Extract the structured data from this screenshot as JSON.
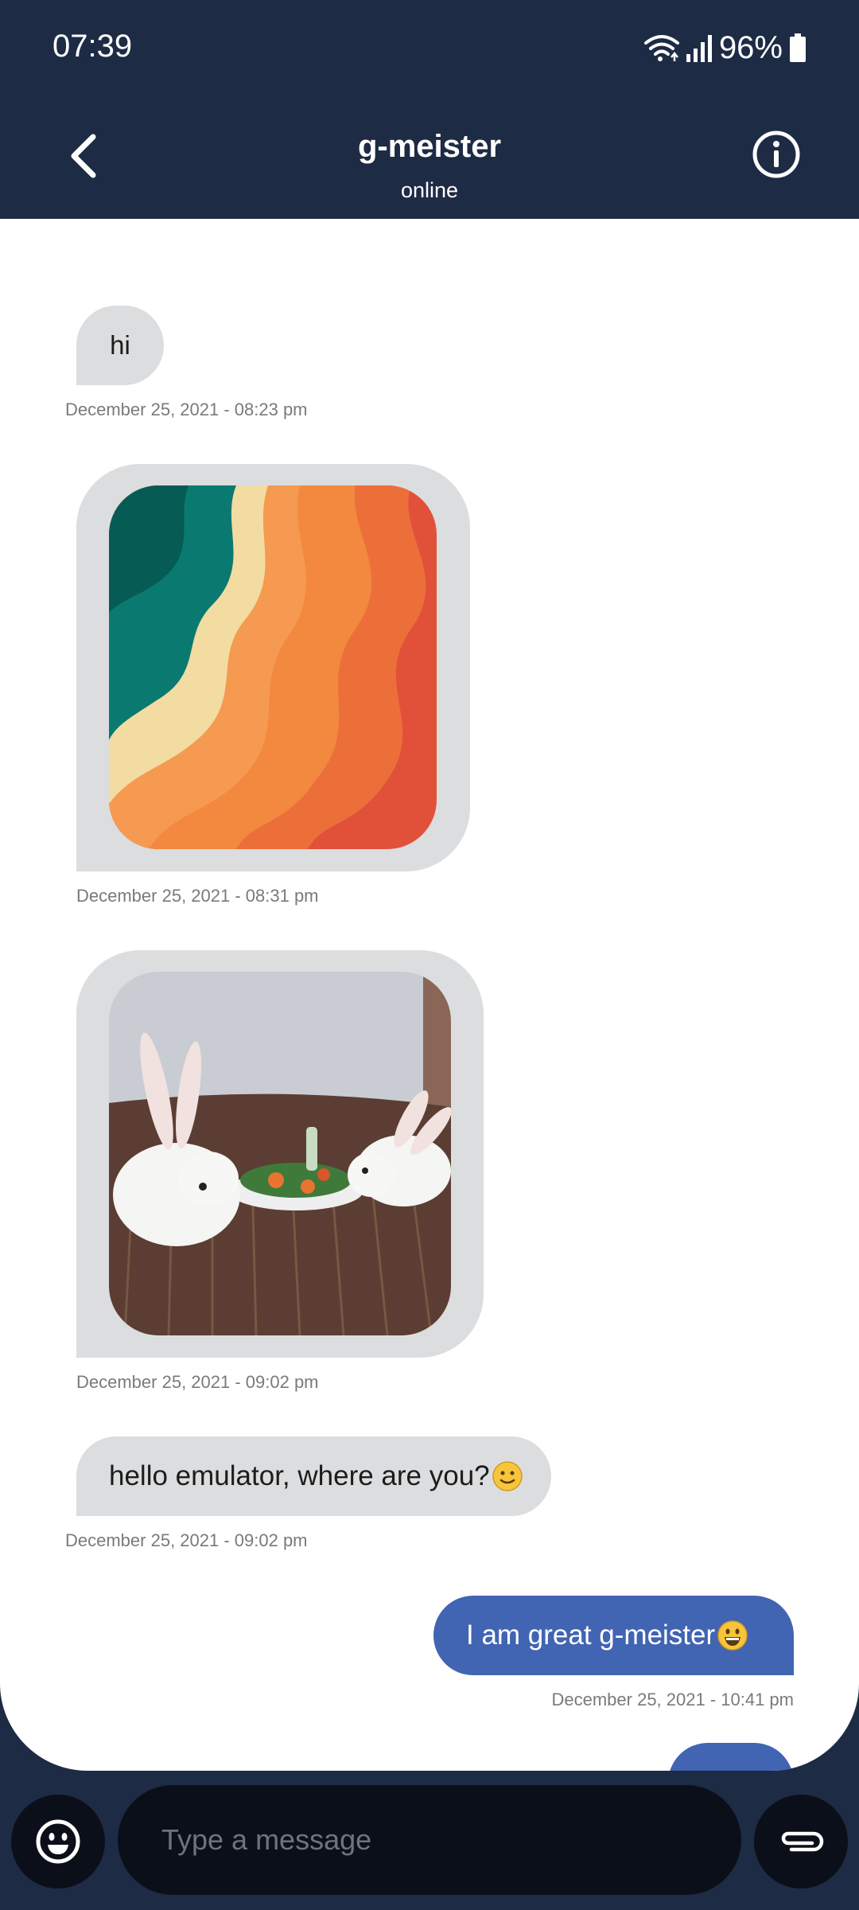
{
  "status_bar": {
    "time": "07:39",
    "battery_pct": "96%"
  },
  "header": {
    "contact_name": "g-meister",
    "contact_status": "online"
  },
  "messages": [
    {
      "direction": "incoming",
      "type": "text",
      "text": "hi",
      "timestamp": "December 25, 2021 - 08:23 pm"
    },
    {
      "direction": "incoming",
      "type": "image",
      "image": "orange-wave-pattern-image",
      "timestamp": "December 25, 2021 - 08:31 pm"
    },
    {
      "direction": "incoming",
      "type": "image",
      "image": "white-rabbits-eating-vegetables-photo",
      "timestamp": "December 25, 2021 - 09:02 pm"
    },
    {
      "direction": "incoming",
      "type": "text",
      "text": "hello emulator, where are you?",
      "emoji": "slightly-smiling-face",
      "timestamp": "December 25, 2021 - 09:02 pm"
    },
    {
      "direction": "outgoing",
      "type": "text",
      "text": "I am great g-meister",
      "emoji": "grinning-face",
      "timestamp": "December 25, 2021 - 10:41 pm"
    }
  ],
  "input": {
    "placeholder": "Type a message"
  },
  "colors": {
    "header_bg": "#1e2b45",
    "chat_bg": "#ffffff",
    "incoming_bubble": "#dcddde",
    "outgoing_bubble": "#4164b3",
    "input_bg": "#0b0f19"
  }
}
